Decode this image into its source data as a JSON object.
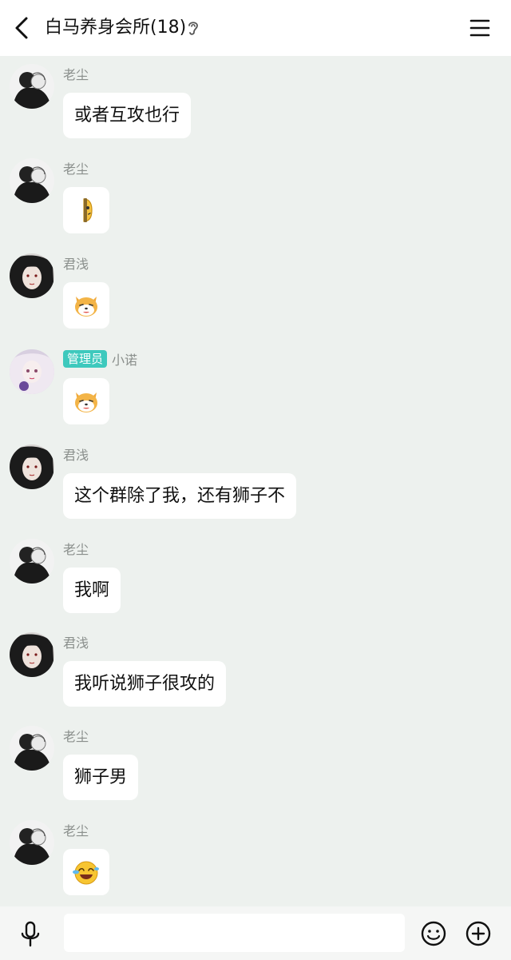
{
  "header": {
    "title": "白马养身会所(18)"
  },
  "roles": {
    "admin_badge": "管理员"
  },
  "messages": [
    {
      "sender": "老尘",
      "avatar": "dark-couple",
      "kind": "text",
      "text": "或者互攻也行"
    },
    {
      "sender": "老尘",
      "avatar": "dark-couple",
      "kind": "sticker",
      "sticker": "peek-face-icon"
    },
    {
      "sender": "君浅",
      "avatar": "dark-hair",
      "kind": "sticker",
      "sticker": "shiba-dog-icon"
    },
    {
      "sender": "小诺",
      "avatar": "pale-girl",
      "kind": "sticker",
      "sticker": "shiba-dog-icon",
      "admin": true
    },
    {
      "sender": "君浅",
      "avatar": "dark-hair",
      "kind": "text",
      "text": "这个群除了我，还有狮子不"
    },
    {
      "sender": "老尘",
      "avatar": "dark-couple",
      "kind": "text",
      "text": "我啊"
    },
    {
      "sender": "君浅",
      "avatar": "dark-hair",
      "kind": "text",
      "text": "我听说狮子很攻的"
    },
    {
      "sender": "老尘",
      "avatar": "dark-couple",
      "kind": "text",
      "text": "狮子男"
    },
    {
      "sender": "老尘",
      "avatar": "dark-couple",
      "kind": "sticker",
      "sticker": "laugh-tears-icon"
    }
  ],
  "icons": {
    "back": "back-arrow-icon",
    "listen": "ear-icon",
    "menu": "menu-icon",
    "voice": "microphone-icon",
    "emoji": "smiley-icon",
    "more": "plus-icon"
  },
  "colors": {
    "chat_background": "#edf1ee",
    "admin_badge": "#3ec9bd",
    "name_gray": "#8a8f8c"
  }
}
